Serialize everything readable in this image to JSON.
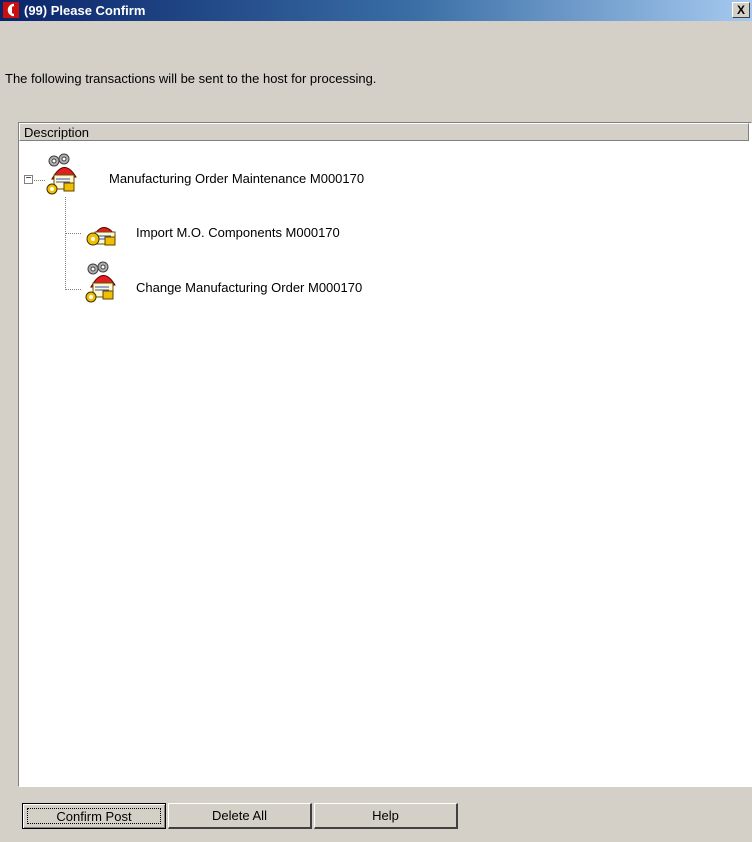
{
  "window": {
    "title": "(99) Please Confirm",
    "close_label": "X",
    "app_icon": "app-logo-icon"
  },
  "message": "The following transactions will be sent to the host for processing.",
  "list": {
    "column_header": "Description",
    "nodes": [
      {
        "label": "Manufacturing Order Maintenance  M000170",
        "icon": "transaction-icon",
        "expanded": true,
        "toggle": "−"
      },
      {
        "label": "Import M.O. Components  M000170",
        "icon": "transaction-icon"
      },
      {
        "label": "Change Manufacturing Order  M000170",
        "icon": "transaction-icon"
      }
    ]
  },
  "buttons": {
    "confirm_post": "Confirm Post",
    "delete_all": "Delete All",
    "help": "Help"
  }
}
